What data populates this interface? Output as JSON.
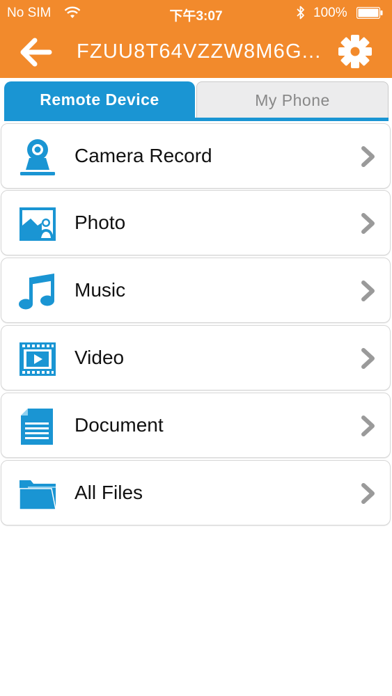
{
  "status_bar": {
    "carrier": "No SIM",
    "time": "下午3:07",
    "battery": "100%"
  },
  "nav": {
    "title": "FZUU8T64VZZW8M6G...",
    "back_icon": "arrow-left-icon",
    "settings_icon": "gear-icon"
  },
  "tabs": [
    {
      "label": "Remote Device",
      "selected": true
    },
    {
      "label": "My Phone",
      "selected": false
    }
  ],
  "items": [
    {
      "label": "Camera Record",
      "icon": "webcam-icon"
    },
    {
      "label": "Photo",
      "icon": "photo-icon"
    },
    {
      "label": "Music",
      "icon": "music-note-icon"
    },
    {
      "label": "Video",
      "icon": "film-icon"
    },
    {
      "label": "Document",
      "icon": "document-icon"
    },
    {
      "label": "All Files",
      "icon": "folder-icon"
    }
  ],
  "colors": {
    "header": "#f28a2c",
    "accent": "#1a95d3",
    "tab_inactive": "#ececed",
    "chevron": "#9a9a9a"
  }
}
